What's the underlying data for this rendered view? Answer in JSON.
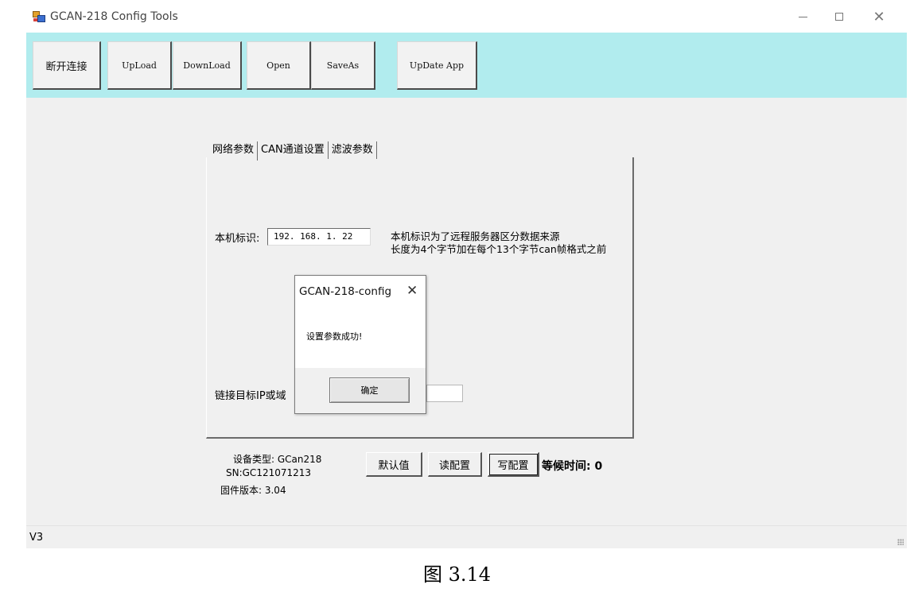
{
  "window": {
    "title": "GCAN-218 Config Tools",
    "close_glyph": "✕"
  },
  "toolbar": {
    "disconnect": "断开连接",
    "upload": "UpLoad",
    "download": "DownLoad",
    "open": "Open",
    "saveas": "SaveAs",
    "update_app": "UpDate App"
  },
  "tabs": [
    "网络参数",
    "CAN通道设置",
    "滤波参数"
  ],
  "network": {
    "local_id_label": "本机标识:",
    "local_id_value": "192. 168. 1. 22",
    "note_line1": "本机标识为了远程服务器区分数据来源",
    "note_line2": "长度为4个字节加在每个13个字节can帧格式之前",
    "target_label": "链接目标IP或域"
  },
  "dialog": {
    "title": "GCAN-218-config",
    "close_glyph": "✕",
    "message": "设置参数成功!",
    "ok": "确定"
  },
  "device": {
    "type": "设备类型: GCan218",
    "sn": "SN:GC121071213",
    "firmware": "固件版本: 3.04"
  },
  "actions": {
    "default": "默认值",
    "read": "读配置",
    "write": "写配置",
    "wait": "等候时间: 0"
  },
  "status": {
    "version": "V3"
  },
  "caption": "图 3.14"
}
